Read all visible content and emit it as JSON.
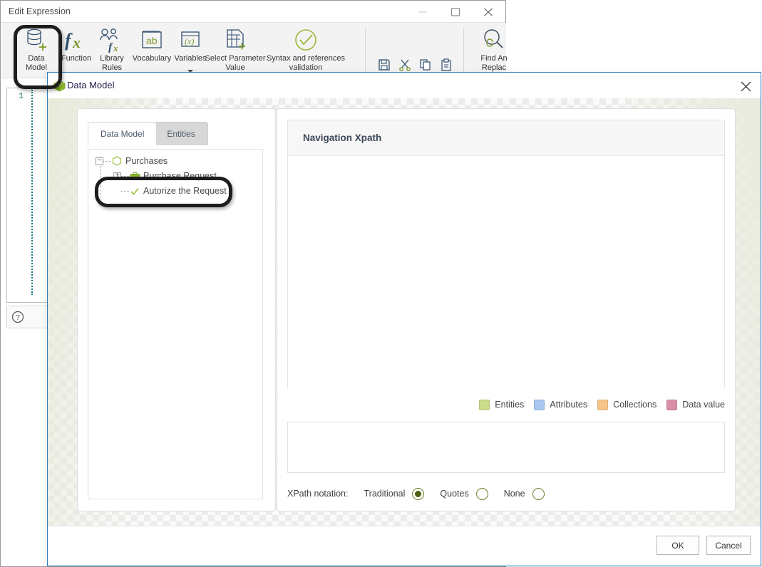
{
  "app_window": {
    "title": "Edit Expression",
    "controls": [
      {
        "name": "minimize-button",
        "glyph": "minimize-icon"
      },
      {
        "name": "maximize-button",
        "glyph": "maximize-icon"
      },
      {
        "name": "close-button",
        "glyph": "close-icon"
      }
    ],
    "ribbon": {
      "items": [
        {
          "label_line1": "Data",
          "label_line2": "Model",
          "icon": "database-add-icon"
        },
        {
          "label_line1": "Function",
          "label_line2": "",
          "icon": "fx-icon"
        },
        {
          "label_line1": "Library",
          "label_line2": "Rules",
          "icon": "library-rules-icon"
        },
        {
          "label_line1": "Vocabulary",
          "label_line2": "",
          "icon": "vocabulary-ab-icon"
        },
        {
          "label_line1": "Variables",
          "label_line2": "",
          "icon": "variables-x-icon"
        },
        {
          "label_line1": "Select Parameter",
          "label_line2": "Value",
          "icon": "select-parameter-icon"
        },
        {
          "label_line1": "Syntax and references",
          "label_line2": "validation",
          "icon": "check-circle-icon"
        }
      ],
      "small_icons": [
        {
          "name": "save-icon"
        },
        {
          "name": "cut-icon"
        },
        {
          "name": "copy-icon"
        },
        {
          "name": "paste-icon"
        },
        {
          "name": "undo-icon"
        },
        {
          "name": "redo-icon"
        },
        {
          "name": "outdent-icon"
        },
        {
          "name": "indent-icon"
        }
      ],
      "find_replace": {
        "label_line1": "Find An",
        "label_line2": "Replac",
        "icon": "find-replace-icon"
      }
    },
    "editor": {
      "line_number": "1",
      "content": "",
      "help_icon": "help-circle-icon"
    }
  },
  "dialog": {
    "title": "Data Model",
    "icon": "green-cube-icon",
    "close_label": "✕",
    "tabs": [
      {
        "label": "Data Model",
        "active": true
      },
      {
        "label": "Entities",
        "active": false
      }
    ],
    "tree": [
      {
        "label": "Purchases",
        "icon": "hexagon-outline-icon",
        "expander": "−",
        "depth": 0
      },
      {
        "label": "Purchase Request",
        "icon": "briefcase-icon",
        "expander": "+",
        "depth": 1
      },
      {
        "label": "Autorize the Request",
        "icon": "check-icon",
        "expander": "",
        "depth": 1
      }
    ],
    "xpath_panel": {
      "title": "Navigation Xpath",
      "canvas_content": ""
    },
    "legend": [
      {
        "label": "Entities",
        "color": "#cddc8a"
      },
      {
        "label": "Attributes",
        "color": "#a8c8f0"
      },
      {
        "label": "Collections",
        "color": "#f7c58a"
      },
      {
        "label": "Data value",
        "color": "#d98fa8"
      }
    ],
    "xpath_output": {
      "value": "",
      "placeholder": ""
    },
    "notation": {
      "label": "XPath notation:",
      "options": [
        {
          "label": "Traditional",
          "selected": true
        },
        {
          "label": "Quotes",
          "selected": false
        },
        {
          "label": "None",
          "selected": false
        }
      ]
    },
    "buttons": {
      "ok": "OK",
      "cancel": "Cancel"
    }
  },
  "annotations": {
    "highlight_1": "data-model-ribbon-button",
    "highlight_2": "autorize-the-request-tree-node"
  }
}
